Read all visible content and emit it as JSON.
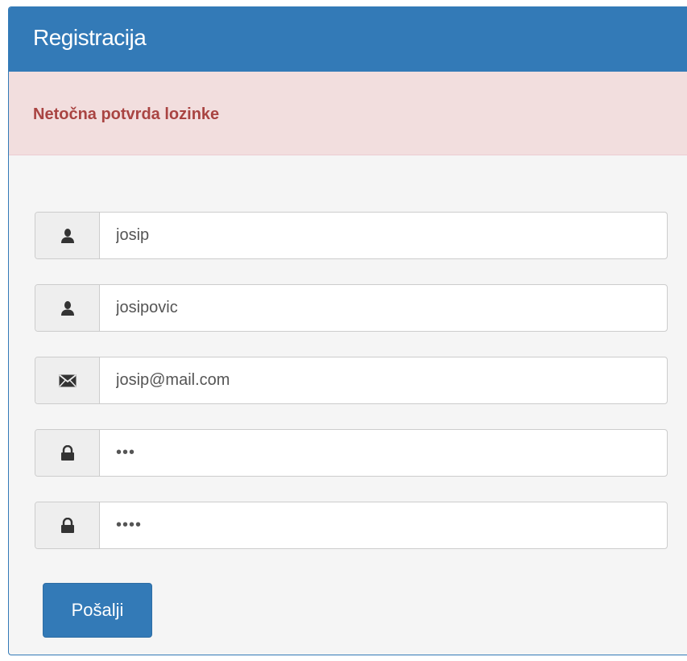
{
  "panel": {
    "title": "Registracija"
  },
  "alert": {
    "message": "Netočna potvrda lozinke"
  },
  "form": {
    "fields": [
      {
        "icon": "user-icon",
        "value": "josip"
      },
      {
        "icon": "user-icon",
        "value": "josipovic"
      },
      {
        "icon": "envelope-icon",
        "value": "josip@mail.com"
      },
      {
        "icon": "lock-icon",
        "value": "•••"
      },
      {
        "icon": "lock-icon",
        "value": "••••"
      }
    ],
    "submit_label": "Pošalji"
  },
  "colors": {
    "primary": "#337ab7",
    "alert_bg": "#f2dede",
    "alert_text": "#a94442",
    "panel_bg": "#f5f5f5"
  }
}
